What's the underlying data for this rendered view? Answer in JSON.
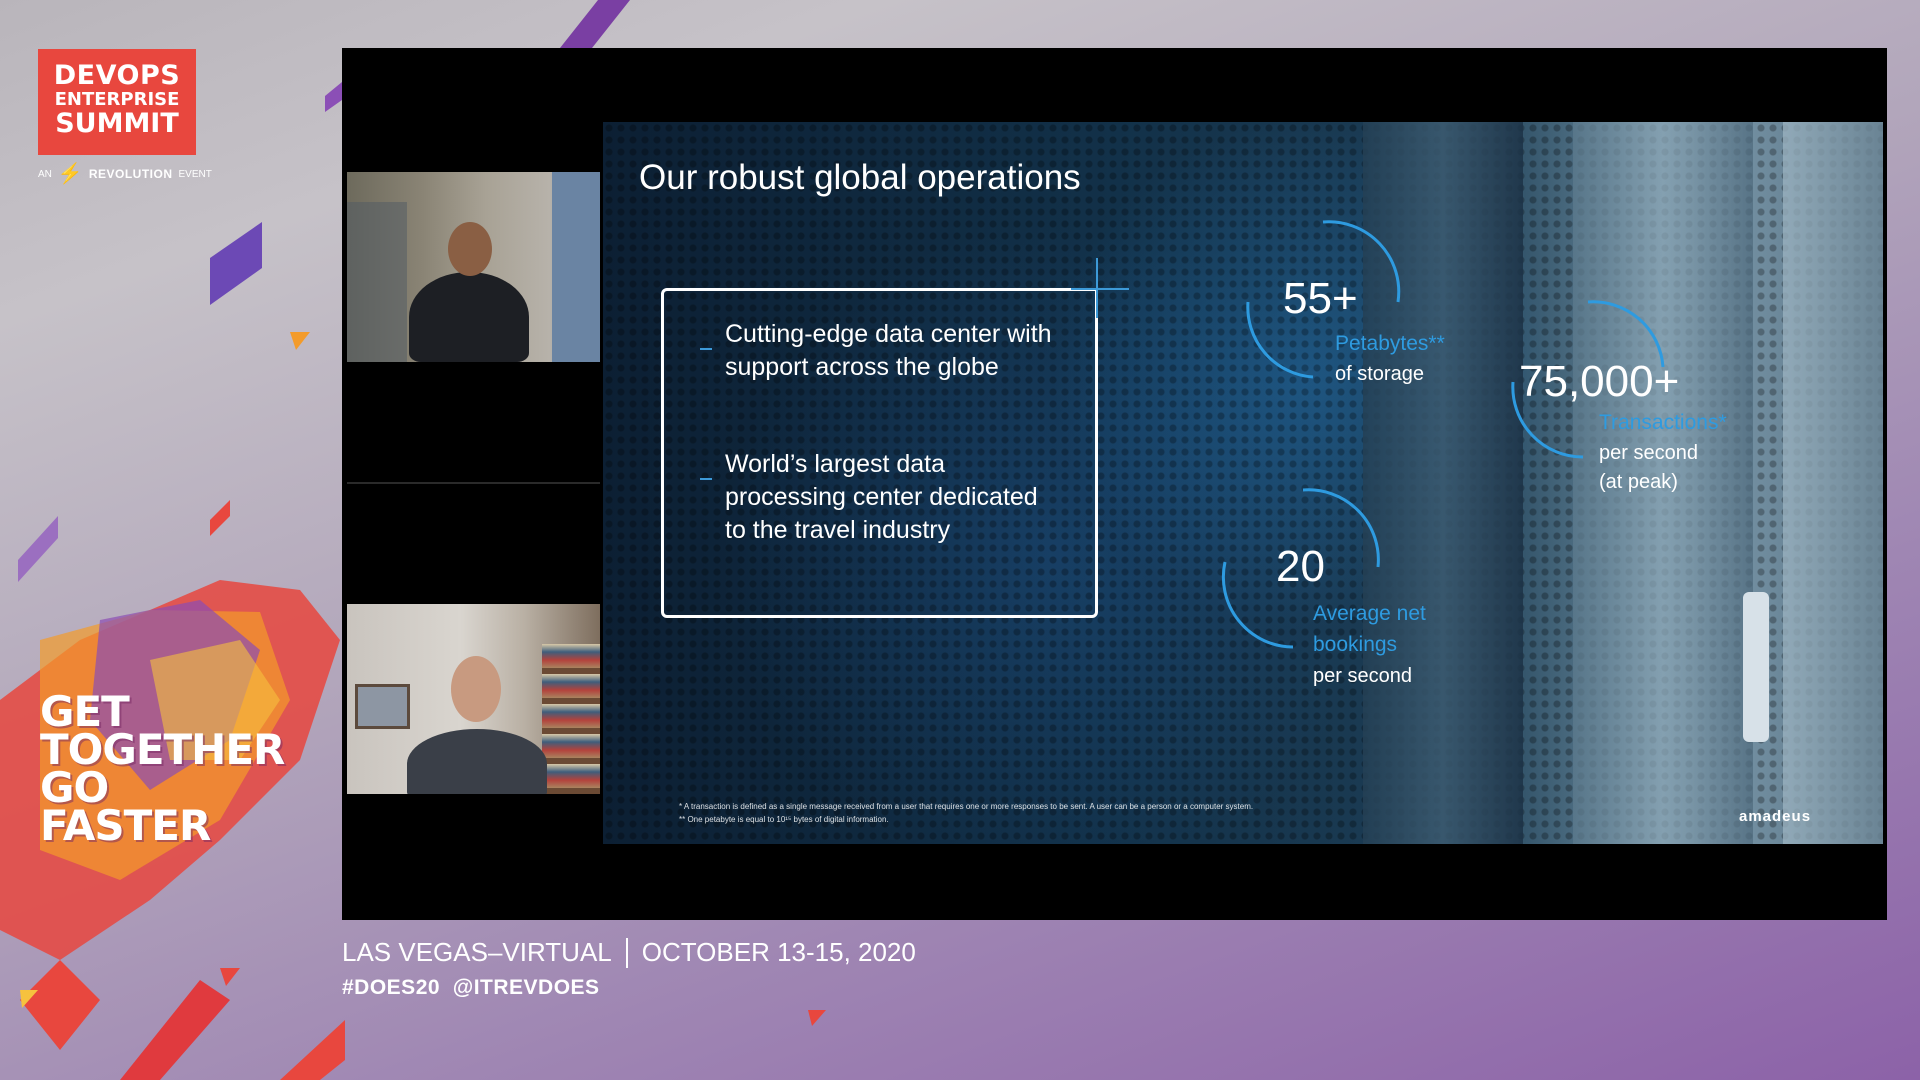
{
  "logo": {
    "line1": "DEVOPS",
    "line2": "ENTERPRISE",
    "line3": "SUMMIT",
    "sub_an": "AN",
    "sub_brand": "REVOLUTION",
    "sub_event": "EVENT",
    "color": "#e8473e"
  },
  "tagline": {
    "line1": "GET",
    "line2": "TOGETHER",
    "line3": "GO",
    "line4": "FASTER"
  },
  "slide": {
    "title": "Our robust global operations",
    "bullets": [
      "Cutting-edge data center with  support across the globe",
      "World’s largest data processing center dedicated to the travel industry"
    ],
    "stats": [
      {
        "value": "55+",
        "label_blue": "Petabytes**",
        "label_white": "of storage"
      },
      {
        "value": "75,000+",
        "label_blue": "Transactions*",
        "label_white": "per second",
        "label_white2": "(at peak)"
      },
      {
        "value": "20",
        "label_blue": "Average net",
        "label_blue2": "bookings",
        "label_white": "per second"
      }
    ],
    "footnotes": [
      "* A transaction is defined as a single message received from a user that requires one or more responses to be sent. A user can be a person or a computer system.",
      "** One petabyte is equal to 10¹⁵ bytes of digital information."
    ],
    "brand": "amadeus",
    "accent_color": "#2e9be0"
  },
  "event": {
    "location": "LAS VEGAS–VIRTUAL",
    "dates": "OCTOBER 13-15, 2020",
    "hashtags": "#DOES20  @ITREVDOES"
  }
}
